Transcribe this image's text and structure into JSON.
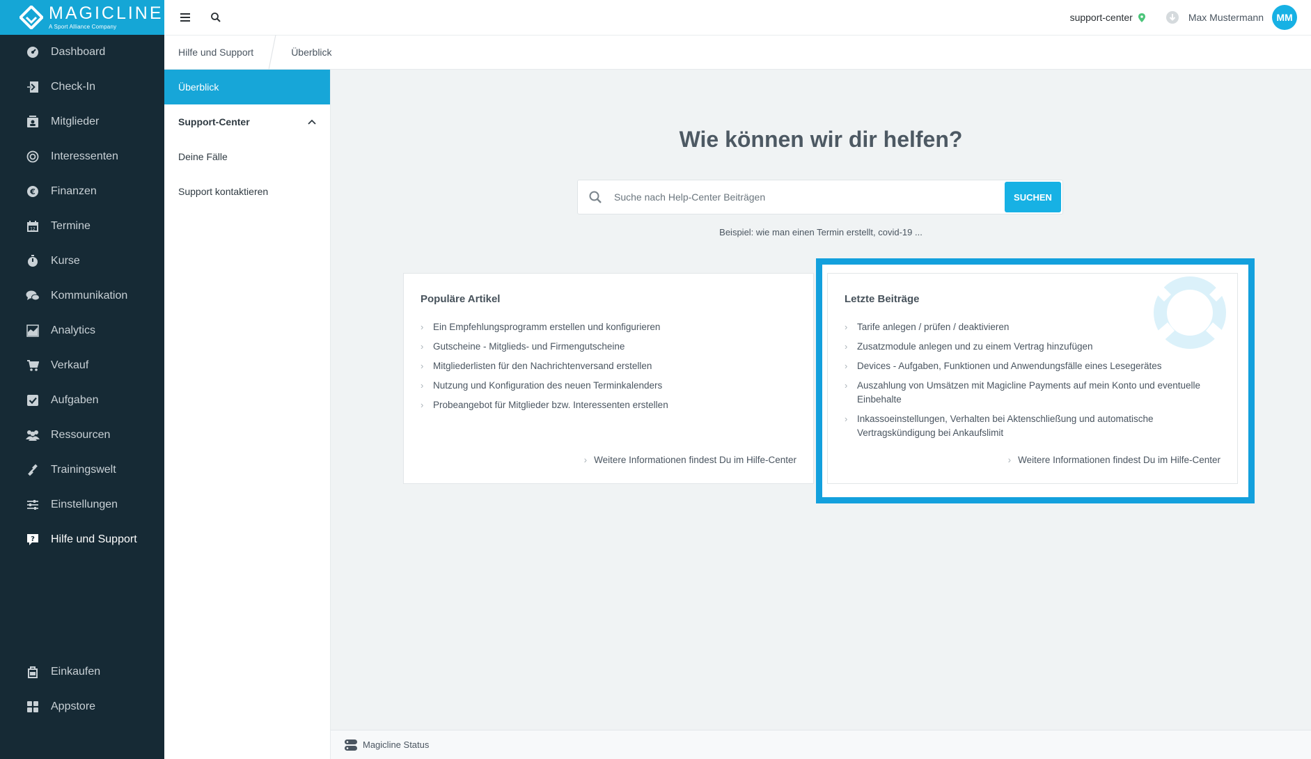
{
  "app": {
    "brand": "MAGICLINE",
    "brand_sub": "A Sport Alliance Company"
  },
  "sidebar": {
    "items": [
      {
        "label": "Dashboard",
        "icon": "dashboard-icon"
      },
      {
        "label": "Check-In",
        "icon": "check-in-icon"
      },
      {
        "label": "Mitglieder",
        "icon": "members-icon"
      },
      {
        "label": "Interessenten",
        "icon": "prospects-icon"
      },
      {
        "label": "Finanzen",
        "icon": "euro-icon"
      },
      {
        "label": "Termine",
        "icon": "calendar-icon"
      },
      {
        "label": "Kurse",
        "icon": "stopwatch-icon"
      },
      {
        "label": "Kommunikation",
        "icon": "chat-icon"
      },
      {
        "label": "Analytics",
        "icon": "chart-icon"
      },
      {
        "label": "Verkauf",
        "icon": "cart-icon"
      },
      {
        "label": "Aufgaben",
        "icon": "checkbox-icon"
      },
      {
        "label": "Ressourcen",
        "icon": "people-icon"
      },
      {
        "label": "Trainingswelt",
        "icon": "dumbbell-icon"
      },
      {
        "label": "Einstellungen",
        "icon": "sliders-icon"
      },
      {
        "label": "Hilfe und Support",
        "icon": "help-icon",
        "active": true
      }
    ],
    "bottom_items": [
      {
        "label": "Einkaufen",
        "icon": "shop-icon"
      },
      {
        "label": "Appstore",
        "icon": "apps-icon"
      }
    ]
  },
  "topbar": {
    "studio": "support-center",
    "user_name": "Max Mustermann",
    "avatar_initials": "MM"
  },
  "breadcrumb": [
    "Hilfe und Support",
    "Überblick"
  ],
  "subnav": {
    "overview": "Überblick",
    "section": "Support-Center",
    "items": [
      "Deine Fälle",
      "Support kontaktieren"
    ]
  },
  "main": {
    "title": "Wie können wir dir helfen?",
    "search_placeholder": "Suche nach Help-Center Beiträgen",
    "search_button": "SUCHEN",
    "example": "Beispiel: wie man einen Termin erstellt, covid-19 ..."
  },
  "popular": {
    "title": "Populäre Artikel",
    "items": [
      "Ein Empfehlungsprogramm erstellen und konfigurieren",
      "Gutscheine - Mitglieds- und Firmengutscheine",
      "Mitgliederlisten für den Nachrichtenversand erstellen",
      "Nutzung und Konfiguration des neuen Terminkalenders",
      "Probeangebot für Mitglieder bzw. Interessenten erstellen"
    ],
    "more": "Weitere Informationen findest Du im Hilfe-Center"
  },
  "latest": {
    "title": "Letzte Beiträge",
    "items": [
      "Tarife anlegen / prüfen / deaktivieren",
      "Zusatzmodule anlegen und zu einem Vertrag hinzufügen",
      "Devices - Aufgaben, Funktionen und Anwendungsfälle eines Lesegerätes",
      "Auszahlung von Umsätzen mit Magicline Payments auf mein Konto und eventuelle Einbehalte",
      "Inkassoeinstellungen, Verhalten bei Aktenschließung und automatische Vertragskündigung bei Ankaufslimit"
    ],
    "more": "Weitere Informationen findest Du im Hilfe-Center"
  },
  "footer": {
    "status": "Magicline Status"
  },
  "colors": {
    "sidebar": "#162a35",
    "accent": "#17b1e4",
    "highlight": "#13a0dd"
  }
}
